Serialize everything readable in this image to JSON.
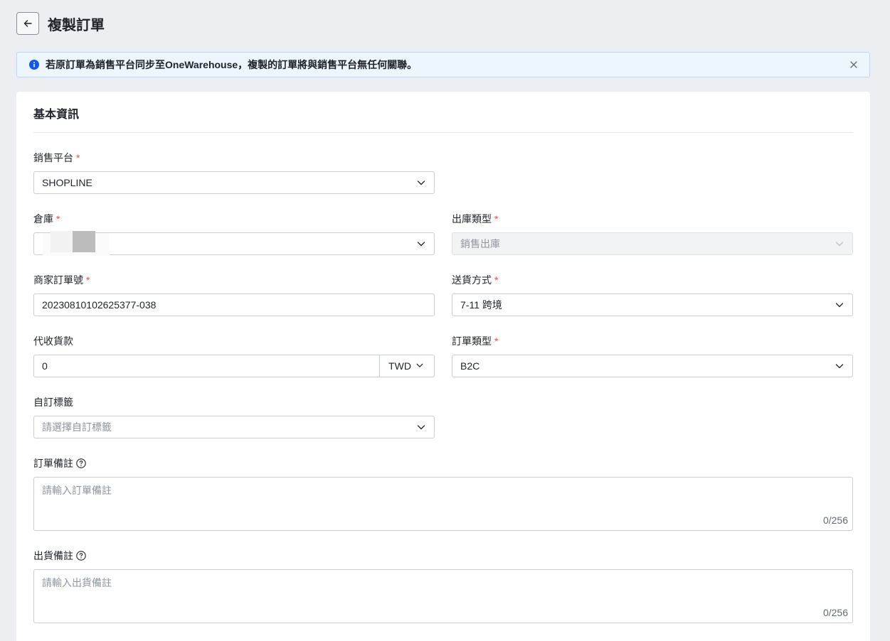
{
  "header": {
    "title": "複製訂單"
  },
  "alert": {
    "text": "若原訂單為銷售平台同步至OneWarehouse，複製的訂單將與銷售平台無任何關聯。"
  },
  "section": {
    "title": "基本資訊"
  },
  "fields": {
    "platform": {
      "label": "銷售平台",
      "value": "SHOPLINE"
    },
    "warehouse": {
      "label": "倉庫",
      "value": ""
    },
    "outbound_type": {
      "label": "出庫類型",
      "value": "銷售出庫"
    },
    "merchant_order_no": {
      "label": "商家訂單號",
      "value": "20230810102625377-038"
    },
    "shipping_method": {
      "label": "送貨方式",
      "value": "7-11 跨境"
    },
    "cod": {
      "label": "代收貨款",
      "value": "0",
      "currency": "TWD"
    },
    "order_type": {
      "label": "訂單類型",
      "value": "B2C"
    },
    "custom_tags": {
      "label": "自訂標籤",
      "placeholder": "請選擇自訂標籤"
    },
    "order_note": {
      "label": "訂單備註",
      "placeholder": "請輸入訂單備註",
      "counter": "0/256"
    },
    "shipping_note": {
      "label": "出貨備註",
      "placeholder": "請輸入出貨備註",
      "counter": "0/256"
    }
  },
  "required_mark": "*",
  "colors": {
    "accent": "#1456f0",
    "required": "#f54a45",
    "alert_bg": "#edf5fe"
  }
}
